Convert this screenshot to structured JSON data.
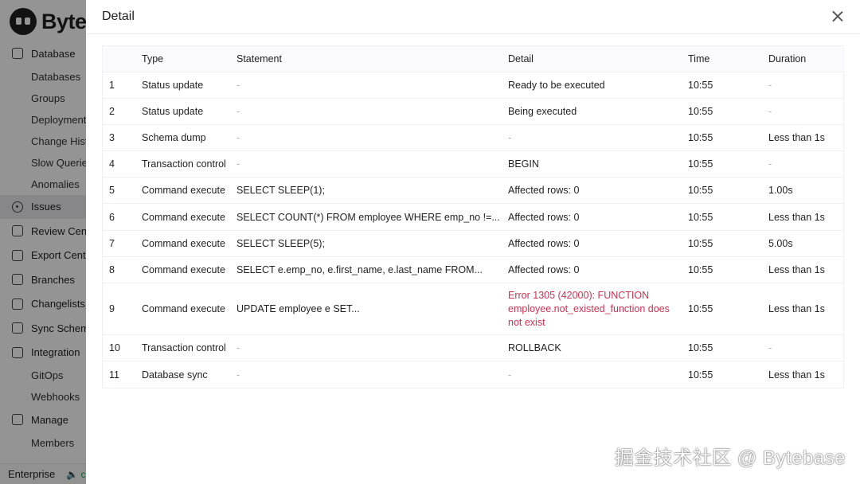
{
  "brand": {
    "name": "Bytebase"
  },
  "sidebar": {
    "items": [
      {
        "label": "Database",
        "icon": "database-icon",
        "sub": false,
        "active": false
      },
      {
        "label": "Databases",
        "sub": true
      },
      {
        "label": "Groups",
        "sub": true
      },
      {
        "label": "Deployment",
        "sub": true
      },
      {
        "label": "Change History",
        "sub": true
      },
      {
        "label": "Slow Queries",
        "sub": true
      },
      {
        "label": "Anomalies",
        "sub": true
      },
      {
        "label": "Issues",
        "icon": "issues-icon",
        "sub": false,
        "active": true
      },
      {
        "label": "Review Center",
        "icon": "review-icon",
        "sub": false
      },
      {
        "label": "Export Center",
        "icon": "export-icon",
        "sub": false
      },
      {
        "label": "Branches",
        "icon": "branch-icon",
        "sub": false
      },
      {
        "label": "Changelists",
        "icon": "changelist-icon",
        "sub": false
      },
      {
        "label": "Sync Schema",
        "icon": "sync-icon",
        "sub": false
      },
      {
        "label": "Integration",
        "icon": "integration-icon",
        "sub": false
      },
      {
        "label": "GitOps",
        "sub": true
      },
      {
        "label": "Webhooks",
        "sub": true
      },
      {
        "label": "Manage",
        "icon": "users-icon",
        "sub": false
      },
      {
        "label": "Members",
        "sub": true
      }
    ],
    "footer": {
      "plan": "Enterprise",
      "status": "c"
    }
  },
  "drawer": {
    "title": "Detail",
    "columns": [
      "",
      "Type",
      "Statement",
      "Detail",
      "Time",
      "Duration"
    ],
    "rows": [
      {
        "index": "1",
        "type": "Status update",
        "statement": "-",
        "detail": "Ready to be executed",
        "time": "10:55",
        "duration": "-"
      },
      {
        "index": "2",
        "type": "Status update",
        "statement": "-",
        "detail": "Being executed",
        "time": "10:55",
        "duration": "-"
      },
      {
        "index": "3",
        "type": "Schema dump",
        "statement": "-",
        "detail": "-",
        "time": "10:55",
        "duration": "Less than 1s"
      },
      {
        "index": "4",
        "type": "Transaction control",
        "statement": "-",
        "detail": "BEGIN",
        "time": "10:55",
        "duration": "-"
      },
      {
        "index": "5",
        "type": "Command execute",
        "statement": "SELECT SLEEP(1);",
        "detail": "Affected rows: 0",
        "time": "10:55",
        "duration": "1.00s"
      },
      {
        "index": "6",
        "type": "Command execute",
        "statement": "SELECT COUNT(*) FROM employee WHERE emp_no !=...",
        "detail": "Affected rows: 0",
        "time": "10:55",
        "duration": "Less than 1s"
      },
      {
        "index": "7",
        "type": "Command execute",
        "statement": "SELECT SLEEP(5);",
        "detail": "Affected rows: 0",
        "time": "10:55",
        "duration": "5.00s"
      },
      {
        "index": "8",
        "type": "Command execute",
        "statement": "SELECT e.emp_no, e.first_name, e.last_name FROM...",
        "detail": "Affected rows: 0",
        "time": "10:55",
        "duration": "Less than 1s"
      },
      {
        "index": "9",
        "type": "Command execute",
        "statement": "UPDATE employee e SET...",
        "detail": "Error 1305 (42000): FUNCTION employee.not_existed_function does not exist",
        "time": "10:55",
        "duration": "Less than 1s",
        "error": true
      },
      {
        "index": "10",
        "type": "Transaction control",
        "statement": "-",
        "detail": "ROLLBACK",
        "time": "10:55",
        "duration": "-"
      },
      {
        "index": "11",
        "type": "Database sync",
        "statement": "-",
        "detail": "-",
        "time": "10:55",
        "duration": "Less than 1s"
      }
    ]
  },
  "colors": {
    "error": "#d03050",
    "muted": "#b0b0b6",
    "overlay": "rgba(0,0,0,0.42)"
  },
  "watermark": "掘金技术社区 @ Bytebase"
}
